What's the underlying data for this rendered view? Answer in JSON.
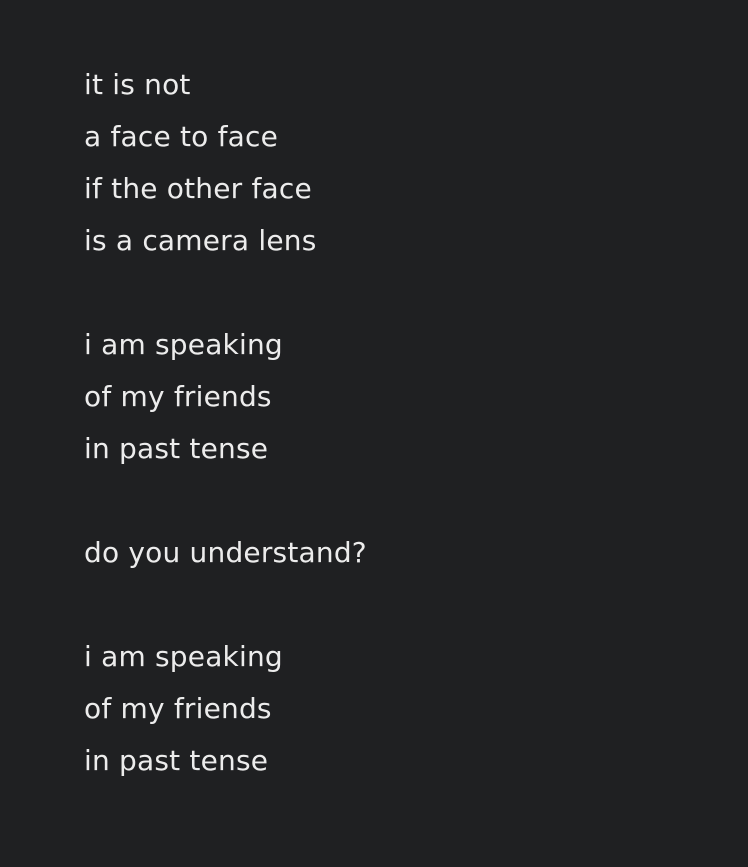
{
  "poem": {
    "stanzas": [
      [
        "it is not",
        "a face to face",
        "if the other face",
        "is a camera lens"
      ],
      [
        "i am speaking",
        "of my friends",
        "in past tense"
      ],
      [
        "do you understand?"
      ],
      [
        "i am speaking",
        "of my friends",
        "in past tense"
      ]
    ]
  },
  "colors": {
    "background": "#1f2022",
    "text": "#ececec"
  }
}
